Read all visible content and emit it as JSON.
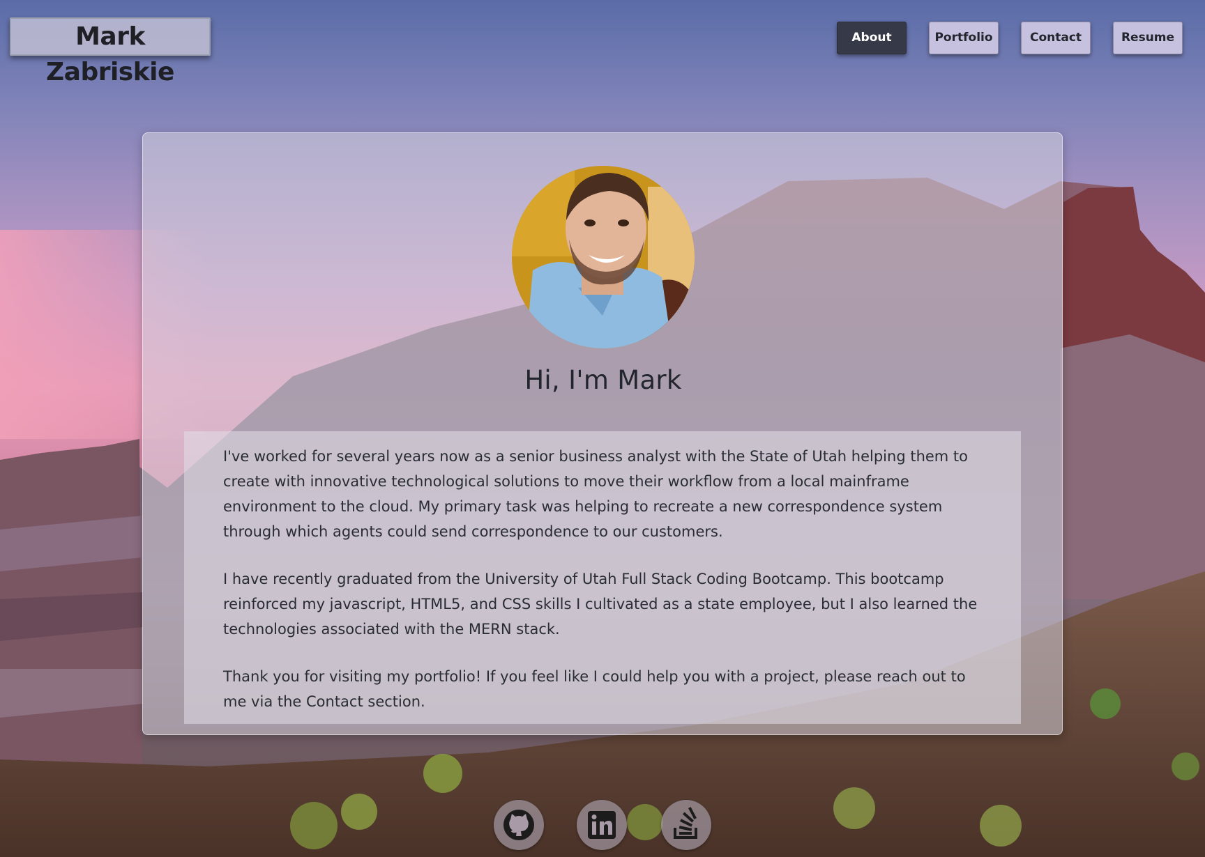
{
  "header": {
    "site_title": "Mark Zabriskie"
  },
  "nav": {
    "items": [
      {
        "label": "About",
        "active": true
      },
      {
        "label": "Portfolio",
        "active": false
      },
      {
        "label": "Contact",
        "active": false
      },
      {
        "label": "Resume",
        "active": false
      }
    ]
  },
  "about": {
    "profile_photo": "profile-photo",
    "greeting": "Hi, I'm Mark",
    "paragraphs": [
      "I've worked for several years now as a senior business analyst with the State of Utah helping them to create with innovative technological solutions to move their workflow from a local mainframe environment to the cloud. My primary task was helping to recreate a new correspondence system through which agents could send correspondence to our customers.",
      "I have recently graduated from the University of Utah Full Stack Coding Bootcamp. This bootcamp reinforced my javascript, HTML5, and CSS skills I cultivated as a state employee, but I also learned the technologies associated with the MERN stack.",
      "Thank you for visiting my portfolio! If you feel like I could help you with a project, please reach out to me via the Contact section."
    ]
  },
  "social": {
    "links": [
      {
        "icon": "github-icon"
      },
      {
        "icon": "linkedin-icon"
      },
      {
        "icon": "stack-overflow-icon"
      }
    ]
  },
  "colors": {
    "active_nav_bg": "#363a48",
    "nav_bg": "#cec8e2",
    "text_dark": "#23252e"
  }
}
